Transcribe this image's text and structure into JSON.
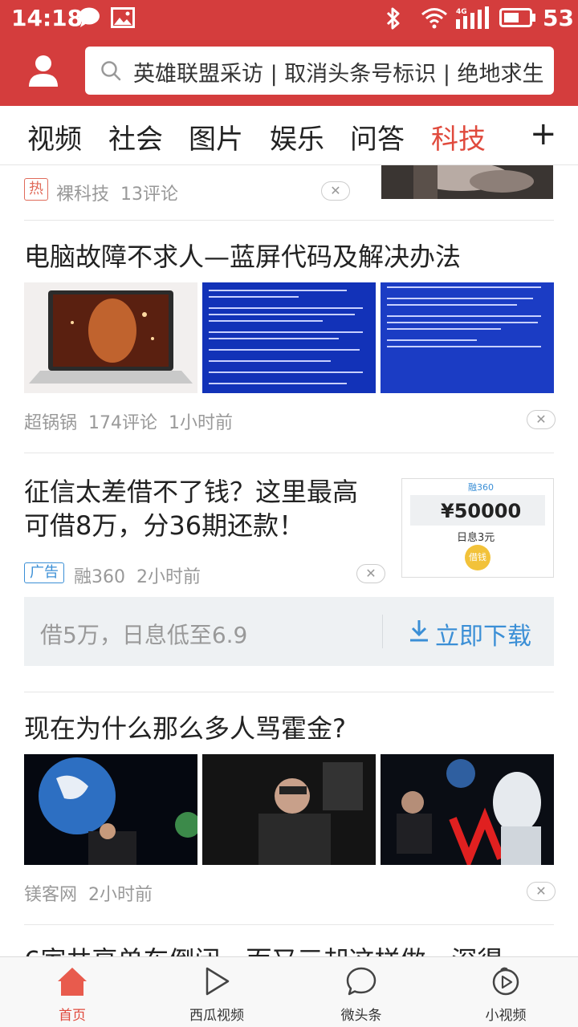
{
  "status_bar": {
    "time": "14:18",
    "battery_level": "53",
    "network": "4G",
    "icons": [
      "message-icon",
      "image-icon",
      "bluetooth-icon",
      "wifi-icon",
      "signal-icon",
      "battery-icon"
    ]
  },
  "header": {
    "search_text": "英雄联盟采访 | 取消头条号标识 | 绝地求生",
    "icons": [
      "user-avatar-icon",
      "search-icon"
    ]
  },
  "tabs": {
    "items": [
      "视频",
      "社会",
      "图片",
      "娱乐",
      "问答",
      "科技"
    ],
    "active": "科技",
    "add_label": "+"
  },
  "feed": {
    "item0": {
      "tag": "热",
      "source": "裸科技",
      "comments": "13评论"
    },
    "item1": {
      "title": "电脑故障不求人—蓝屏代码及解决办法",
      "source": "超锅锅",
      "comments": "174评论",
      "time": "1小时前"
    },
    "ad": {
      "title": "征信太差借不了钱？这里最高可借8万，分36期还款！",
      "tag": "广告",
      "source": "融360",
      "time": "2小时前",
      "image_brand": "融360",
      "image_amount": "¥50000",
      "image_rate": "日息3元",
      "image_button": "借钱",
      "bar_text": "借5万，日息低至6.9",
      "download_label": "立即下载"
    },
    "item2": {
      "title": "现在为什么那么多人骂霍金?",
      "source": "镁客网",
      "time": "2小时前"
    },
    "item3": {
      "title_partial": "6家共享单车倒闭，而又三却这样做，深得"
    }
  },
  "bottom_nav": {
    "items": [
      "首页",
      "西瓜视频",
      "微头条",
      "小视频"
    ],
    "active": "首页"
  },
  "colors": {
    "brand_red": "#d43d3d",
    "active_tab": "#e04a3d",
    "ad_blue": "#3b8fd6"
  }
}
